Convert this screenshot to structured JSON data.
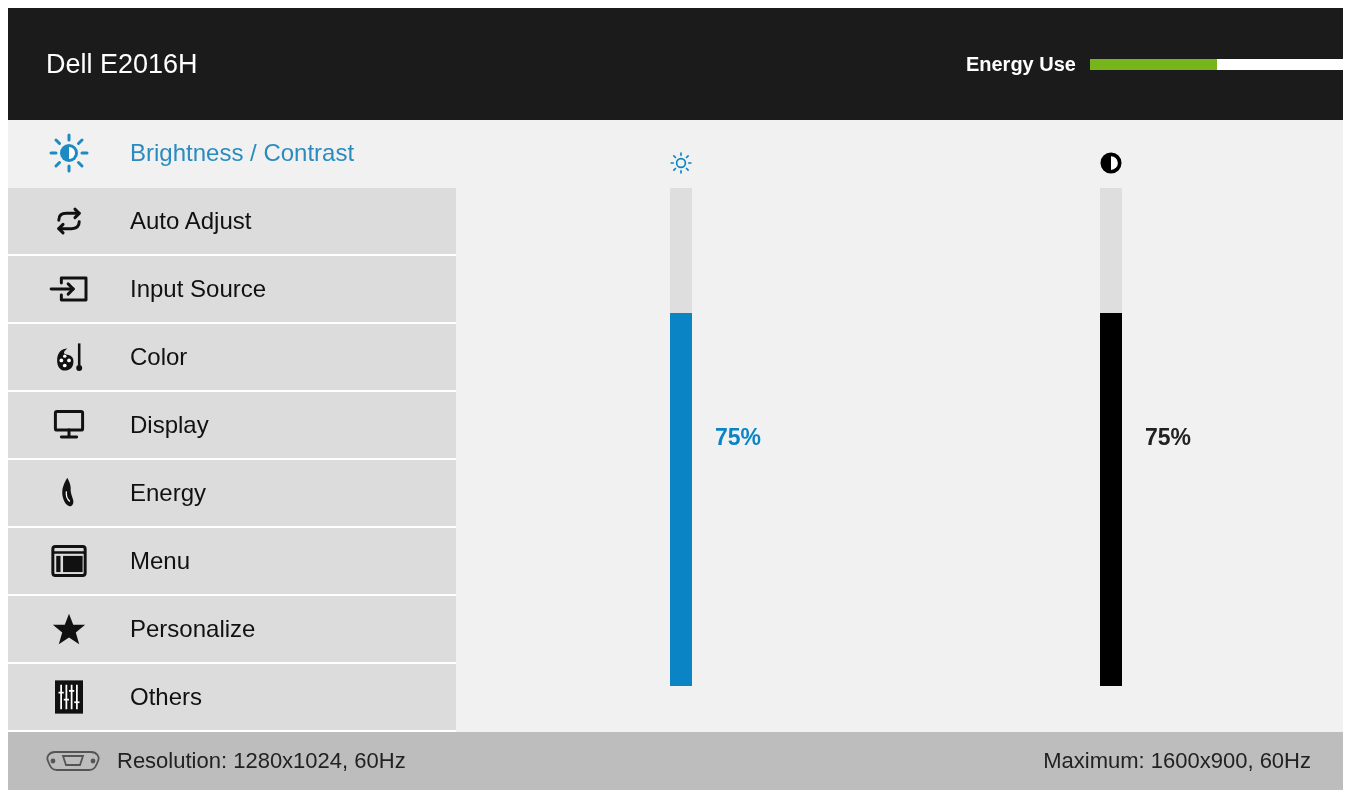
{
  "header": {
    "title": "Dell E2016H",
    "energy_use": {
      "label": "Energy Use",
      "level": 0.5
    }
  },
  "menu": {
    "items": [
      {
        "label": "Brightness / Contrast",
        "selected": true
      },
      {
        "label": "Auto Adjust",
        "selected": false
      },
      {
        "label": "Input Source",
        "selected": false
      },
      {
        "label": "Color",
        "selected": false
      },
      {
        "label": "Display",
        "selected": false
      },
      {
        "label": "Energy",
        "selected": false
      },
      {
        "label": "Menu",
        "selected": false
      },
      {
        "label": "Personalize",
        "selected": false
      },
      {
        "label": "Others",
        "selected": false
      }
    ]
  },
  "sliders": [
    {
      "label": "75%",
      "level": 0.75,
      "color": "#0b84c6"
    },
    {
      "label": "75%",
      "level": 0.75,
      "color": "#000000"
    }
  ],
  "status_bar": {
    "resolution": "Resolution: 1280x1024, 60Hz",
    "maximum": "Maximum: 1600x900, 60Hz"
  }
}
